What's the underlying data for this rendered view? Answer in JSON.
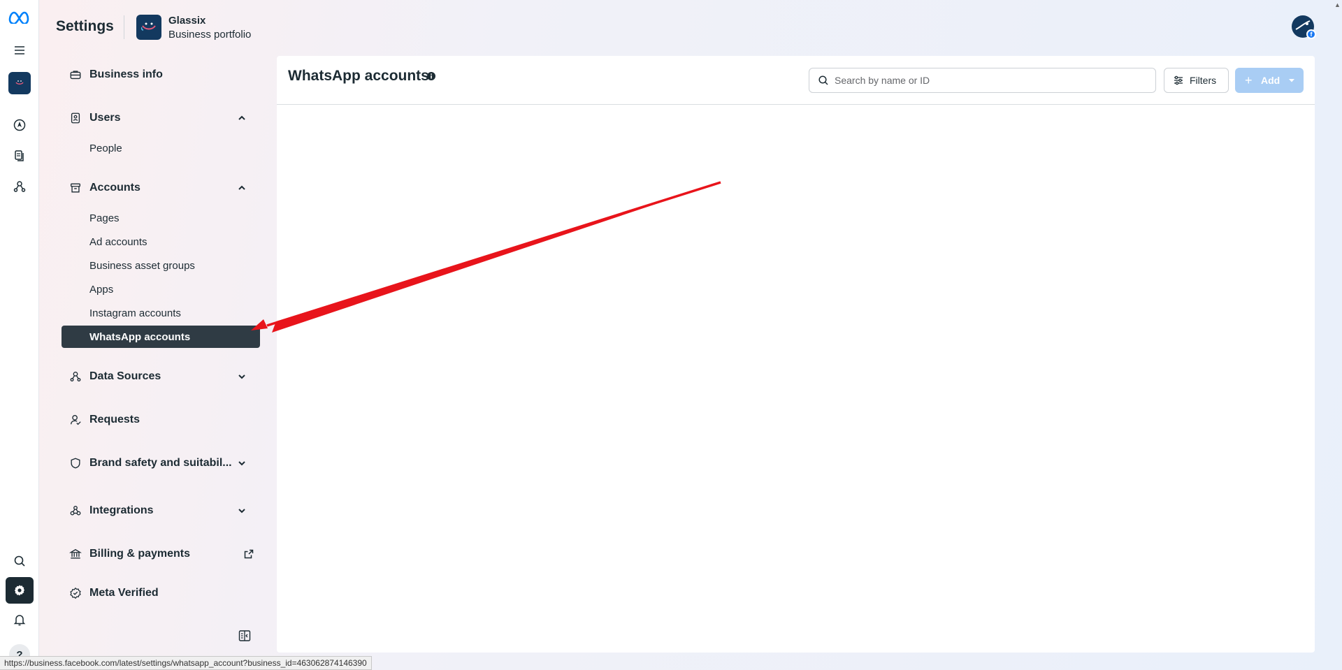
{
  "header": {
    "title": "Settings",
    "portfolio_name": "Glassix",
    "portfolio_type": "Business portfolio"
  },
  "nav": {
    "business_info": "Business info",
    "users": "Users",
    "people": "People",
    "accounts": "Accounts",
    "pages": "Pages",
    "ad_accounts": "Ad accounts",
    "business_asset_groups": "Business asset groups",
    "apps": "Apps",
    "instagram_accounts": "Instagram accounts",
    "whatsapp_accounts": "WhatsApp accounts",
    "data_sources": "Data Sources",
    "requests": "Requests",
    "brand_safety": "Brand safety and suitabil...",
    "integrations": "Integrations",
    "billing": "Billing & payments",
    "meta_verified": "Meta Verified"
  },
  "main": {
    "title": "WhatsApp accounts",
    "search_placeholder": "Search by name or ID",
    "filters_label": "Filters",
    "add_label": "Add"
  },
  "statusbar": {
    "url": "https://business.facebook.com/latest/settings/whatsapp_account?business_id=463062874146390"
  },
  "colors": {
    "active_nav_bg": "#2f3b44",
    "rail_active_bg": "#1c2b33",
    "add_button_disabled": "#a9cdf4",
    "annotation_arrow": "#e8141b",
    "meta_blue": "#0081fb"
  },
  "icons": {
    "rail": [
      "meta-logo-icon",
      "menu-icon",
      "portfolio-icon",
      "compass-icon",
      "pages-icon",
      "network-icon",
      "search-icon",
      "gear-icon",
      "bell-icon",
      "help-icon"
    ],
    "nav": [
      "briefcase-icon",
      "badge-icon",
      "archive-icon",
      "data-sources-icon",
      "person-check-icon",
      "shield-icon",
      "integrations-icon",
      "bank-icon",
      "verified-icon"
    ]
  }
}
